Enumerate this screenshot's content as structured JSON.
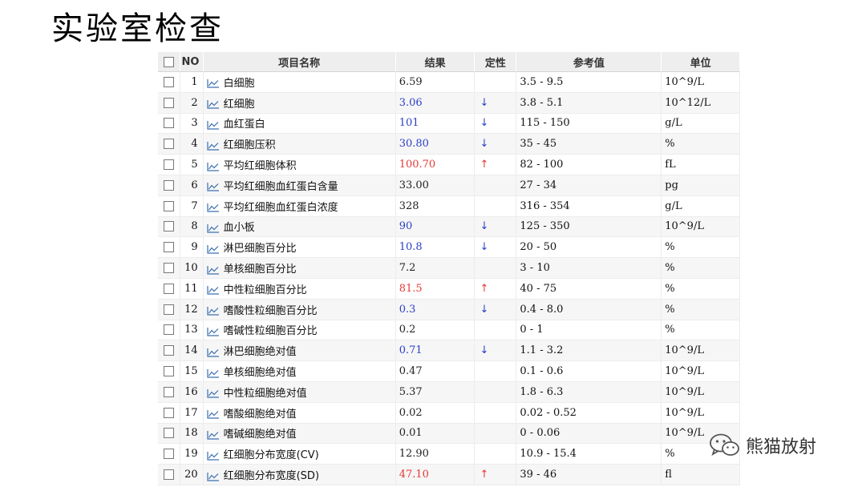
{
  "slide": {
    "title": "实验室检查"
  },
  "table": {
    "headers": {
      "no": "NO",
      "name": "项目名称",
      "result": "结果",
      "flag": "定性",
      "reference": "参考值",
      "unit": "单位"
    },
    "rows": [
      {
        "no": "1",
        "name": "白细胞",
        "result": "6.59",
        "status": "normal",
        "flag": "",
        "reference": "3.5 - 9.5",
        "unit": "10^9/L"
      },
      {
        "no": "2",
        "name": "红细胞",
        "result": "3.06",
        "status": "low",
        "flag": "↓",
        "reference": "3.8 - 5.1",
        "unit": "10^12/L"
      },
      {
        "no": "3",
        "name": "血红蛋白",
        "result": "101",
        "status": "low",
        "flag": "↓",
        "reference": "115 - 150",
        "unit": "g/L"
      },
      {
        "no": "4",
        "name": "红细胞压积",
        "result": "30.80",
        "status": "low",
        "flag": "↓",
        "reference": "35 - 45",
        "unit": "%"
      },
      {
        "no": "5",
        "name": "平均红细胞体积",
        "result": "100.70",
        "status": "high",
        "flag": "↑",
        "reference": "82 - 100",
        "unit": "fL"
      },
      {
        "no": "6",
        "name": "平均红细胞血红蛋白含量",
        "result": "33.00",
        "status": "normal",
        "flag": "",
        "reference": "27 - 34",
        "unit": "pg"
      },
      {
        "no": "7",
        "name": "平均红细胞血红蛋白浓度",
        "result": "328",
        "status": "normal",
        "flag": "",
        "reference": "316 - 354",
        "unit": "g/L"
      },
      {
        "no": "8",
        "name": "血小板",
        "result": "90",
        "status": "low",
        "flag": "↓",
        "reference": "125 - 350",
        "unit": "10^9/L"
      },
      {
        "no": "9",
        "name": "淋巴细胞百分比",
        "result": "10.8",
        "status": "low",
        "flag": "↓",
        "reference": "20 - 50",
        "unit": "%"
      },
      {
        "no": "10",
        "name": "单核细胞百分比",
        "result": "7.2",
        "status": "normal",
        "flag": "",
        "reference": "3 - 10",
        "unit": "%"
      },
      {
        "no": "11",
        "name": "中性粒细胞百分比",
        "result": "81.5",
        "status": "high",
        "flag": "↑",
        "reference": "40 - 75",
        "unit": "%"
      },
      {
        "no": "12",
        "name": "嗜酸性粒细胞百分比",
        "result": "0.3",
        "status": "low",
        "flag": "↓",
        "reference": "0.4 - 8.0",
        "unit": "%"
      },
      {
        "no": "13",
        "name": "嗜碱性粒细胞百分比",
        "result": "0.2",
        "status": "normal",
        "flag": "",
        "reference": "0 - 1",
        "unit": "%"
      },
      {
        "no": "14",
        "name": "淋巴细胞绝对值",
        "result": "0.71",
        "status": "low",
        "flag": "↓",
        "reference": "1.1 - 3.2",
        "unit": "10^9/L"
      },
      {
        "no": "15",
        "name": "单核细胞绝对值",
        "result": "0.47",
        "status": "normal",
        "flag": "",
        "reference": "0.1 - 0.6",
        "unit": "10^9/L"
      },
      {
        "no": "16",
        "name": "中性粒细胞绝对值",
        "result": "5.37",
        "status": "normal",
        "flag": "",
        "reference": "1.8 - 6.3",
        "unit": "10^9/L"
      },
      {
        "no": "17",
        "name": "嗜酸细胞绝对值",
        "result": "0.02",
        "status": "normal",
        "flag": "",
        "reference": "0.02 - 0.52",
        "unit": "10^9/L"
      },
      {
        "no": "18",
        "name": "嗜碱细胞绝对值",
        "result": "0.01",
        "status": "normal",
        "flag": "",
        "reference": "0 - 0.06",
        "unit": "10^9/L"
      },
      {
        "no": "19",
        "name": "红细胞分布宽度(CV)",
        "result": "12.90",
        "status": "normal",
        "flag": "",
        "reference": "10.9 - 15.4",
        "unit": "%"
      },
      {
        "no": "20",
        "name": "红细胞分布宽度(SD)",
        "result": "47.10",
        "status": "high",
        "flag": "↑",
        "reference": "39 - 46",
        "unit": "fl"
      }
    ]
  },
  "watermark": {
    "text": "熊猫放射",
    "icon": "wechat-icon"
  },
  "colors": {
    "high": "#e53935",
    "low": "#2b3fc7",
    "normal": "#222222",
    "trend_icon": "#3a6fb0"
  }
}
